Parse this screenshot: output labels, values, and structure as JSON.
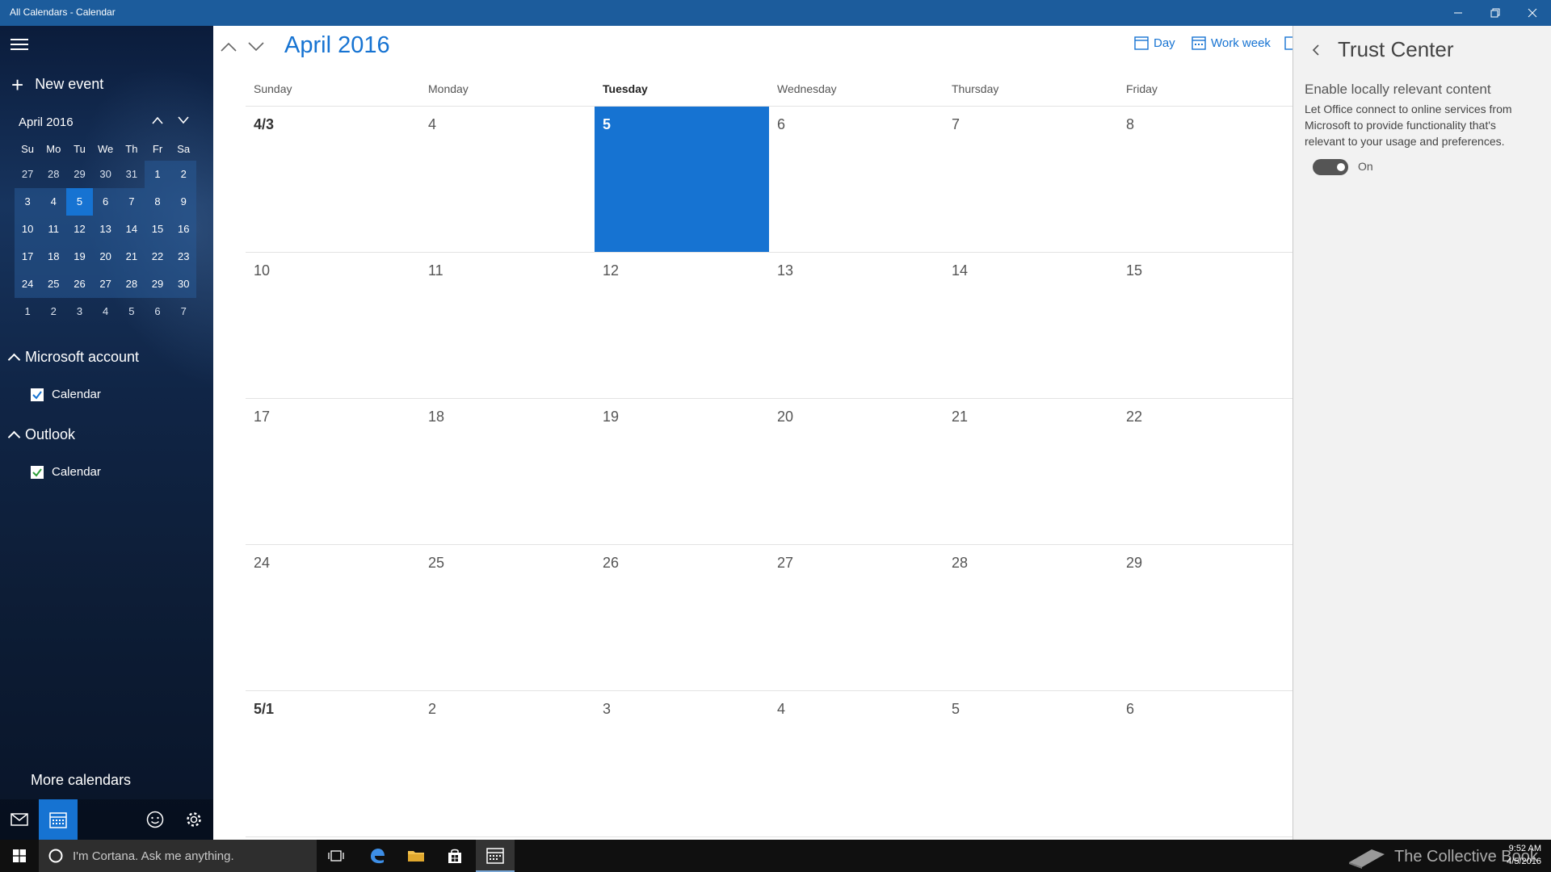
{
  "window": {
    "title": "All Calendars - Calendar"
  },
  "sidebar": {
    "new_event_label": "New event",
    "mini_month_title": "April 2016",
    "mini_calendar": {
      "weekdays": [
        "Su",
        "Mo",
        "Tu",
        "We",
        "Th",
        "Fr",
        "Sa"
      ],
      "weeks": [
        [
          "27",
          "28",
          "29",
          "30",
          "31",
          "1",
          "2"
        ],
        [
          "3",
          "4",
          "5",
          "6",
          "7",
          "8",
          "9"
        ],
        [
          "10",
          "11",
          "12",
          "13",
          "14",
          "15",
          "16"
        ],
        [
          "17",
          "18",
          "19",
          "20",
          "21",
          "22",
          "23"
        ],
        [
          "24",
          "25",
          "26",
          "27",
          "28",
          "29",
          "30"
        ],
        [
          "1",
          "2",
          "3",
          "4",
          "5",
          "6",
          "7"
        ]
      ]
    },
    "accounts": [
      {
        "name": "Microsoft account",
        "calendar_label": "Calendar",
        "check_color": "#1673d2"
      },
      {
        "name": "Outlook",
        "calendar_label": "Calendar",
        "check_color": "#2e9e3a"
      }
    ],
    "more_calendars_label": "More calendars"
  },
  "main": {
    "month_title": "April 2016",
    "views": {
      "day_label": "Day",
      "workweek_label": "Work week"
    },
    "weekdays": [
      "Sunday",
      "Monday",
      "Tuesday",
      "Wednesday",
      "Thursday",
      "Friday"
    ],
    "weeks": [
      [
        "4/3",
        "4",
        "5",
        "6",
        "7",
        "8"
      ],
      [
        "10",
        "11",
        "12",
        "13",
        "14",
        "15"
      ],
      [
        "17",
        "18",
        "19",
        "20",
        "21",
        "22"
      ],
      [
        "24",
        "25",
        "26",
        "27",
        "28",
        "29"
      ],
      [
        "5/1",
        "2",
        "3",
        "4",
        "5",
        "6"
      ]
    ]
  },
  "trust_center": {
    "title": "Trust Center",
    "setting_title": "Enable locally relevant content",
    "setting_description": "Let Office connect to online services from Microsoft to provide functionality that's relevant to your usage and preferences.",
    "toggle_label": "On"
  },
  "taskbar": {
    "cortana_placeholder": "I'm Cortana. Ask me anything.",
    "watermark": "The Collective Book",
    "time": "9:52 AM",
    "date": "4/5/2016"
  },
  "colors": {
    "accent": "#1673d2",
    "titlebar": "#1c5c9c"
  }
}
